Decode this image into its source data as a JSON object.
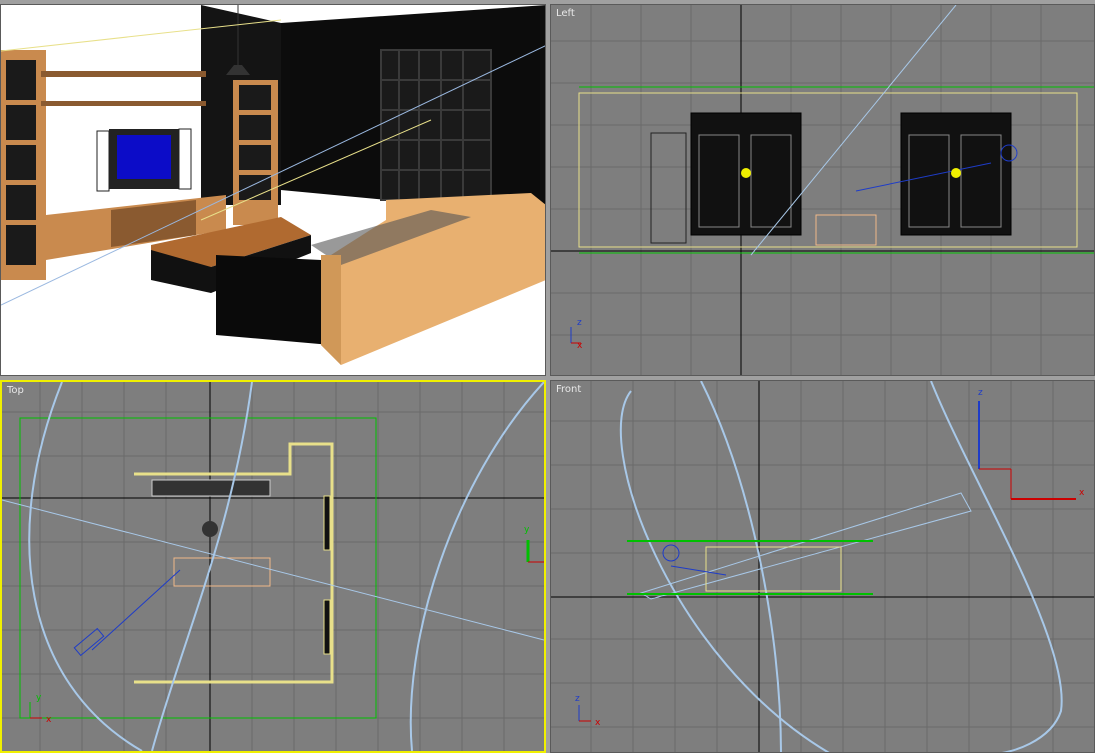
{
  "viewports": {
    "perspective": {
      "label": ""
    },
    "left": {
      "label": "Left"
    },
    "top": {
      "label": "Top"
    },
    "front": {
      "label": "Front"
    }
  },
  "axes": {
    "x": "x",
    "y": "y",
    "z": "z"
  },
  "colors": {
    "viewport_bg": "#7e7e7e",
    "grid": "#6c6c6c",
    "grid_major": "#000000",
    "active_border": "#f0f000",
    "wire_yellow": "#e8e08a",
    "wire_green": "#00c000",
    "wire_blue": "#1e3cc8",
    "wire_light": "#a8c8e8",
    "sofa": "#f0b888"
  }
}
